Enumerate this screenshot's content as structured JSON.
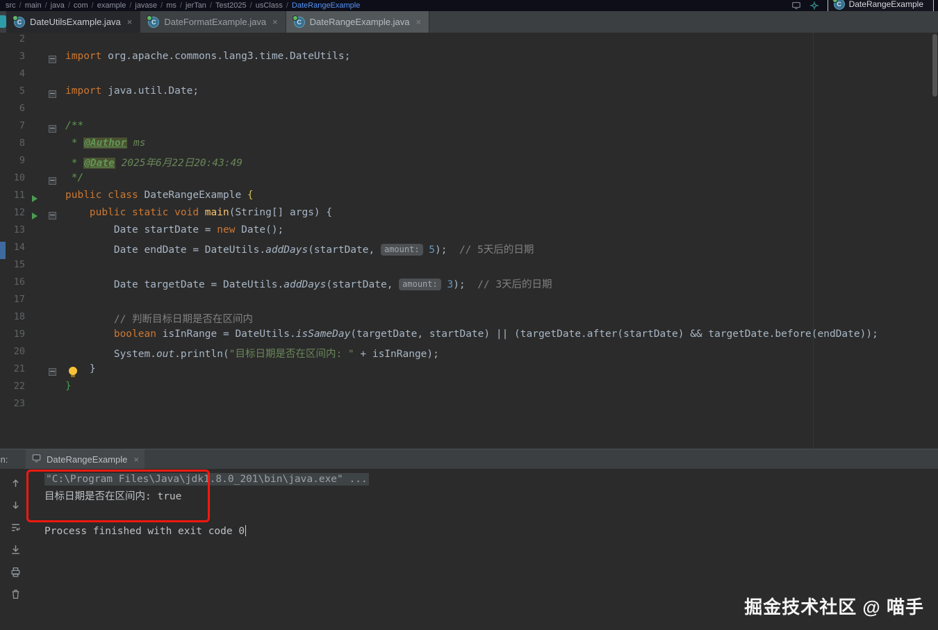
{
  "topbar": {
    "breadcrumb_segments": [
      "src",
      "main",
      "java",
      "com",
      "example",
      "javase",
      "ms",
      "jerTan",
      "Test2025",
      "usClass"
    ],
    "breadcrumb_current": "DateRangeExample",
    "run_config_label": "DateRangeExample",
    "right_icons": [
      "monitor-icon",
      "locate-icon"
    ]
  },
  "tabs": [
    {
      "label": "DateUtilsExample.java",
      "state": "dark"
    },
    {
      "label": "DateFormatExample.java",
      "state": "normal"
    },
    {
      "label": "DateRangeExample.java",
      "state": "selected"
    }
  ],
  "editor": {
    "lines": [
      {
        "n": "2",
        "tk": []
      },
      {
        "n": "3",
        "fold": true,
        "tk": [
          [
            "kw",
            "import"
          ],
          [
            "pl",
            " org.apache.commons.lang3.time.DateUtils;"
          ]
        ]
      },
      {
        "n": "4",
        "tk": []
      },
      {
        "n": "5",
        "fold": true,
        "tk": [
          [
            "kw",
            "import"
          ],
          [
            "pl",
            " java.util.Date;"
          ]
        ]
      },
      {
        "n": "6",
        "tk": []
      },
      {
        "n": "7",
        "fold": true,
        "tk": [
          [
            "doc",
            "/**"
          ]
        ]
      },
      {
        "n": "8",
        "tk": [
          [
            "doc",
            " * "
          ],
          [
            "tag",
            "@Author"
          ],
          [
            "docv",
            " ms"
          ]
        ]
      },
      {
        "n": "9",
        "tk": [
          [
            "doc",
            " * "
          ],
          [
            "tag",
            "@Date"
          ],
          [
            "docv",
            " 2025年6月22日20:43:49"
          ]
        ]
      },
      {
        "n": "10",
        "fold": true,
        "tk": [
          [
            "doc",
            " */"
          ]
        ]
      },
      {
        "n": "11",
        "run": true,
        "tk": [
          [
            "kw",
            "public class "
          ],
          [
            "pl",
            "DateRangeExample "
          ],
          [
            "ylw",
            "{"
          ]
        ]
      },
      {
        "n": "12",
        "run": true,
        "fold": true,
        "tk": [
          [
            "pl",
            "    "
          ],
          [
            "kw",
            "public static void "
          ],
          [
            "meth",
            "main"
          ],
          [
            "pl",
            "(String[] args) {"
          ]
        ]
      },
      {
        "n": "13",
        "tk": [
          [
            "pl",
            "        Date startDate = "
          ],
          [
            "kw",
            "new"
          ],
          [
            "pl",
            " Date();"
          ]
        ]
      },
      {
        "n": "14",
        "mark": true,
        "tk": [
          [
            "pl",
            "        Date endDate = DateUtils."
          ],
          [
            "itm",
            "addDays"
          ],
          [
            "pl",
            "(startDate, "
          ],
          [
            "hint",
            "amount:"
          ],
          [
            "pl",
            " "
          ],
          [
            "num",
            "5"
          ],
          [
            "pl",
            ");  "
          ],
          [
            "cmt",
            "// 5天后的日期"
          ]
        ]
      },
      {
        "n": "15",
        "tk": []
      },
      {
        "n": "16",
        "tk": [
          [
            "pl",
            "        Date targetDate = DateUtils."
          ],
          [
            "itm",
            "addDays"
          ],
          [
            "pl",
            "(startDate, "
          ],
          [
            "hint",
            "amount:"
          ],
          [
            "pl",
            " "
          ],
          [
            "num",
            "3"
          ],
          [
            "pl",
            ");  "
          ],
          [
            "cmt",
            "// 3天后的日期"
          ]
        ]
      },
      {
        "n": "17",
        "tk": []
      },
      {
        "n": "18",
        "tk": [
          [
            "pl",
            "        "
          ],
          [
            "cmt",
            "// 判断目标日期是否在区间内"
          ]
        ]
      },
      {
        "n": "19",
        "tk": [
          [
            "pl",
            "        "
          ],
          [
            "kw",
            "boolean"
          ],
          [
            "pl",
            " isInRange = DateUtils."
          ],
          [
            "itm",
            "isSameDay"
          ],
          [
            "pl",
            "(targetDate, startDate) || (targetDate.after(startDate) && targetDate.before(endDate));"
          ]
        ]
      },
      {
        "n": "20",
        "tk": [
          [
            "pl",
            "        System."
          ],
          [
            "itm",
            "out"
          ],
          [
            "pl",
            ".println("
          ],
          [
            "str",
            "\"目标日期是否在区间内: \""
          ],
          [
            "pl",
            " + isInRange);"
          ]
        ]
      },
      {
        "n": "21",
        "fold": true,
        "bulb": true,
        "tk": [
          [
            "pl",
            "    }"
          ]
        ]
      },
      {
        "n": "22",
        "tk": [
          [
            "grn",
            "}"
          ]
        ]
      },
      {
        "n": "23",
        "tk": []
      }
    ]
  },
  "run_panel": {
    "label": "Run:",
    "tab_label": "DateRangeExample",
    "toolbar_icons": [
      "up-arrow-icon",
      "down-arrow-icon",
      "soft-wrap-icon",
      "scroll-to-end-icon",
      "print-icon",
      "clear-icon"
    ],
    "console_lines": [
      {
        "cls": "path",
        "text": "\"C:\\Program Files\\Java\\jdk1.8.0_201\\bin\\java.exe\" ..."
      },
      {
        "cls": "plain",
        "text": "目标日期是否在区间内: true"
      },
      {
        "cls": "blank",
        "text": ""
      },
      {
        "cls": "plain",
        "text": "Process finished with exit code 0",
        "caret": true
      }
    ]
  },
  "watermark": "掘金技术社区 @ 喵手",
  "colors": {
    "editor_bg": "#2b2b2b",
    "keyword": "#CC7832",
    "string": "#6A8759",
    "comment": "#808080",
    "number": "#6897BB",
    "javadoc": "#629755",
    "run_green": "#499C54",
    "accent_blue": "#5693f5",
    "annotation_red": "#f2180f"
  }
}
